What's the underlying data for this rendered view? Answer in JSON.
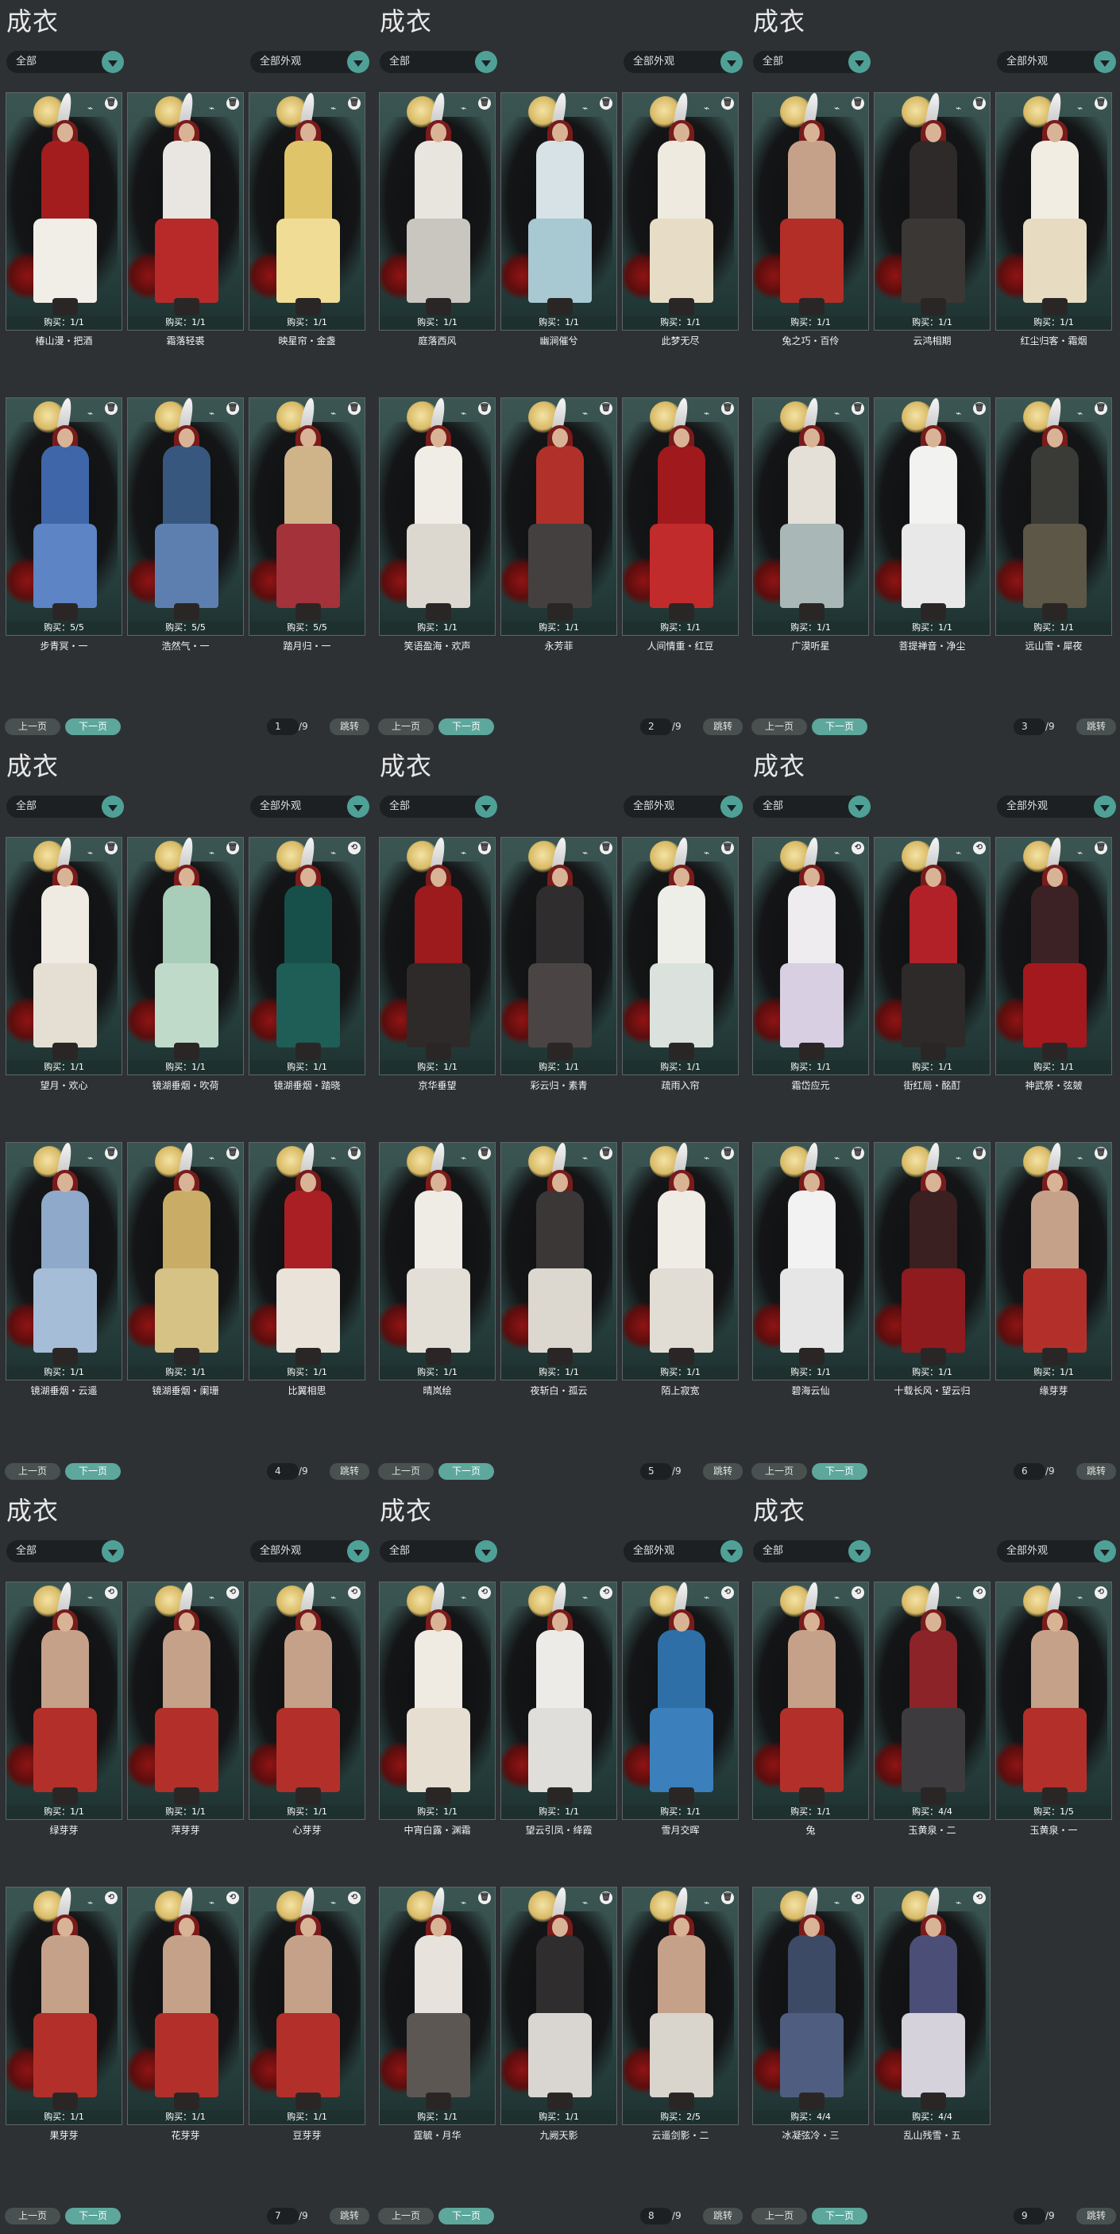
{
  "filter_all": "全部",
  "filter_appearance": "全部外观",
  "prev_label": "上一页",
  "next_label": "下一页",
  "jump_label": "跳转",
  "panels": [
    {
      "title": "成衣",
      "page": "1",
      "total": "/9",
      "cards": [
        {
          "buy": "购买：1/1",
          "name": "椿山漫・把酒",
          "color": "#a31d1f",
          "skirt": "#f1ede7",
          "icon": "trash"
        },
        {
          "buy": "购买：1/1",
          "name": "霜落轻裘",
          "color": "#e9e6e2",
          "skirt": "#b82a2a",
          "icon": "trash"
        },
        {
          "buy": "购买：1/1",
          "name": "映星帘・金盏",
          "color": "#e0c46a",
          "skirt": "#f1dc96",
          "icon": "trash"
        },
        {
          "buy": "购买：5/5",
          "name": "步青冥・一",
          "color": "#3f66a8",
          "skirt": "#5d84c4",
          "icon": "trash"
        },
        {
          "buy": "购买：5/5",
          "name": "浩然气・一",
          "color": "#38577f",
          "skirt": "#5d7fb0",
          "icon": "trash"
        },
        {
          "buy": "购买：5/5",
          "name": "踏月归・一",
          "color": "#cfb48a",
          "skirt": "#a4323a",
          "icon": "trash"
        }
      ]
    },
    {
      "title": "成衣",
      "page": "2",
      "total": "/9",
      "cards": [
        {
          "buy": "购买：1/1",
          "name": "庭落西风",
          "color": "#e8e4de",
          "skirt": "#c9c6c0",
          "icon": "trash"
        },
        {
          "buy": "购买：1/1",
          "name": "幽涧催兮",
          "color": "#d7e2e6",
          "skirt": "#a8c8d2",
          "icon": "trash"
        },
        {
          "buy": "购买：1/1",
          "name": "此梦无尽",
          "color": "#efeae0",
          "skirt": "#e7ddc7",
          "icon": "trash"
        },
        {
          "buy": "购买：1/1",
          "name": "笑语盈海・欢声",
          "color": "#f0ede7",
          "skirt": "#dcd7cf",
          "icon": "trash"
        },
        {
          "buy": "购买：1/1",
          "name": "永芳菲",
          "color": "#b13029",
          "skirt": "#444040",
          "icon": "trash"
        },
        {
          "buy": "购买：1/1",
          "name": "人间情重・红豆",
          "color": "#a0191c",
          "skirt": "#c22b2b",
          "icon": "trash"
        }
      ]
    },
    {
      "title": "成衣",
      "page": "3",
      "total": "/9",
      "cards": [
        {
          "buy": "购买：1/1",
          "name": "兔之巧・百伶",
          "color": "#c6a18a",
          "skirt": "#b32e26",
          "icon": "trash"
        },
        {
          "buy": "购买：1/1",
          "name": "云鸿相期",
          "color": "#2e2a2a",
          "skirt": "#3b3735",
          "icon": "trash"
        },
        {
          "buy": "购买：1/1",
          "name": "红尘归客・霜烟",
          "color": "#f1ede3",
          "skirt": "#e7dcc2",
          "icon": "trash"
        },
        {
          "buy": "购买：1/1",
          "name": "广漠听星",
          "color": "#e4e0d8",
          "skirt": "#a9b8b6",
          "icon": "trash"
        },
        {
          "buy": "购买：1/1",
          "name": "菩提禅音・净尘",
          "color": "#f2f2f0",
          "skirt": "#e8e8e8",
          "icon": "trash"
        },
        {
          "buy": "购买：1/1",
          "name": "远山雪・犀夜",
          "color": "#3a3a36",
          "skirt": "#5c5746",
          "icon": "trash"
        }
      ]
    },
    {
      "title": "成衣",
      "page": "4",
      "total": "/9",
      "cards": [
        {
          "buy": "购买：1/1",
          "name": "望月・欢心",
          "color": "#efebe3",
          "skirt": "#e5dfd3",
          "icon": "trash"
        },
        {
          "buy": "购买：1/1",
          "name": "镜湖垂烟・吹荷",
          "color": "#a8cdb8",
          "skirt": "#c0dac9",
          "icon": "trash"
        },
        {
          "buy": "购买：1/1",
          "name": "镜湖垂烟・踏晓",
          "color": "#17504a",
          "skirt": "#1e5e57",
          "icon": "swap"
        },
        {
          "buy": "购买：1/1",
          "name": "镜湖垂烟・云遥",
          "color": "#8ea9c9",
          "skirt": "#a6bdd8",
          "icon": "trash"
        },
        {
          "buy": "购买：1/1",
          "name": "镜湖垂烟・阑珊",
          "color": "#c9ad66",
          "skirt": "#d6c285",
          "icon": "trash"
        },
        {
          "buy": "购买：1/1",
          "name": "比翼相思",
          "color": "#aa1f23",
          "skirt": "#e9e3da",
          "icon": "trash"
        }
      ]
    },
    {
      "title": "成衣",
      "page": "5",
      "total": "/9",
      "cards": [
        {
          "buy": "购买：1/1",
          "name": "京华垂望",
          "color": "#9d1a1d",
          "skirt": "#2e2a2a",
          "icon": "trash"
        },
        {
          "buy": "购买：1/1",
          "name": "彩云归・素青",
          "color": "#2f2d2d",
          "skirt": "#4a4544",
          "icon": "trash"
        },
        {
          "buy": "购买：1/1",
          "name": "疏雨入帘",
          "color": "#eeeee8",
          "skirt": "#dbe2de",
          "icon": "trash"
        },
        {
          "buy": "购买：1/1",
          "name": "晴岚绘",
          "color": "#efece6",
          "skirt": "#e3ded6",
          "icon": "trash"
        },
        {
          "buy": "购买：1/1",
          "name": "夜斩白・孤云",
          "color": "#3a3736",
          "skirt": "#dcd7cf",
          "icon": "trash"
        },
        {
          "buy": "购买：1/1",
          "name": "陌上寂宽",
          "color": "#efebe5",
          "skirt": "#e2ddd4",
          "icon": "trash"
        }
      ]
    },
    {
      "title": "成衣",
      "page": "6",
      "total": "/9",
      "cards": [
        {
          "buy": "购买：1/1",
          "name": "霜岱应元",
          "color": "#efecef",
          "skirt": "#d8cfe3",
          "icon": "swap"
        },
        {
          "buy": "购买：1/1",
          "name": "街红局・酩酊",
          "color": "#b22127",
          "skirt": "#2e2a2a",
          "icon": "swap"
        },
        {
          "buy": "购买：1/1",
          "name": "神武祭・弦皴",
          "color": "#3c2224",
          "skirt": "#a3191d",
          "icon": "trash"
        },
        {
          "buy": "购买：1/1",
          "name": "碧海云仙",
          "color": "#f2f2f2",
          "skirt": "#e6e6e6",
          "icon": "trash"
        },
        {
          "buy": "购买：1/1",
          "name": "十载长风・望云归",
          "color": "#3b2021",
          "skirt": "#8f1b1f",
          "icon": "trash"
        },
        {
          "buy": "购买：1/1",
          "name": "缘芽芽",
          "color": "#c6a18a",
          "skirt": "#b3302a",
          "icon": "trash"
        }
      ]
    },
    {
      "title": "成衣",
      "page": "7",
      "total": "/9",
      "cards": [
        {
          "buy": "购买：1/1",
          "name": "绿芽芽",
          "color": "#c6a18a",
          "skirt": "#b3302a",
          "icon": "swap"
        },
        {
          "buy": "购买：1/1",
          "name": "萍芽芽",
          "color": "#c6a18a",
          "skirt": "#b3302a",
          "icon": "swap"
        },
        {
          "buy": "购买：1/1",
          "name": "心芽芽",
          "color": "#c6a18a",
          "skirt": "#b3302a",
          "icon": "swap"
        },
        {
          "buy": "购买：1/1",
          "name": "果芽芽",
          "color": "#c6a18a",
          "skirt": "#b3302a",
          "icon": "swap"
        },
        {
          "buy": "购买：1/1",
          "name": "花芽芽",
          "color": "#c6a18a",
          "skirt": "#b3302a",
          "icon": "swap"
        },
        {
          "buy": "购买：1/1",
          "name": "豆芽芽",
          "color": "#c6a18a",
          "skirt": "#b3302a",
          "icon": "swap"
        }
      ]
    },
    {
      "title": "成衣",
      "page": "8",
      "total": "/9",
      "cards": [
        {
          "buy": "购买：1/1",
          "name": "中宵白露・渊霜",
          "color": "#efebe2",
          "skirt": "#e6dfd1",
          "icon": "swap"
        },
        {
          "buy": "购买：1/1",
          "name": "望云引凤・绛霞",
          "color": "#ecebe8",
          "skirt": "#dfdedb",
          "icon": "swap"
        },
        {
          "buy": "购买：1/1",
          "name": "雪月交晖",
          "color": "#2f6fa8",
          "skirt": "#3b80bd",
          "icon": "swap"
        },
        {
          "buy": "购买：1/1",
          "name": "霆毓・月华",
          "color": "#e7e3dc",
          "skirt": "#5c5752",
          "icon": "trash"
        },
        {
          "buy": "购买：1/1",
          "name": "九阙天影",
          "color": "#2f2d2d",
          "skirt": "#d9d6d2",
          "icon": "trash"
        },
        {
          "buy": "购买：2/5",
          "name": "云遥剑影・二",
          "color": "#c6a18a",
          "skirt": "#d9d4cc",
          "icon": "trash"
        }
      ]
    },
    {
      "title": "成衣",
      "page": "9",
      "total": "/9",
      "cards": [
        {
          "buy": "购买：1/1",
          "name": "兔",
          "color": "#c6a18a",
          "skirt": "#b3302a",
          "icon": "swap"
        },
        {
          "buy": "购买：4/4",
          "name": "玉黄泉・二",
          "color": "#8b2328",
          "skirt": "#3e3b3e",
          "icon": "swap"
        },
        {
          "buy": "购买：1/5",
          "name": "玉黄泉・一",
          "color": "#c6a18a",
          "skirt": "#b3302a",
          "icon": "swap"
        },
        {
          "buy": "购买：4/4",
          "name": "冰凝弦冷・三",
          "color": "#3c4a66",
          "skirt": "#4f5e80",
          "icon": "swap"
        },
        {
          "buy": "购买：4/4",
          "name": "乱山残雪・五",
          "color": "#4b4f77",
          "skirt": "#d5d2dc",
          "icon": "swap"
        }
      ]
    }
  ]
}
